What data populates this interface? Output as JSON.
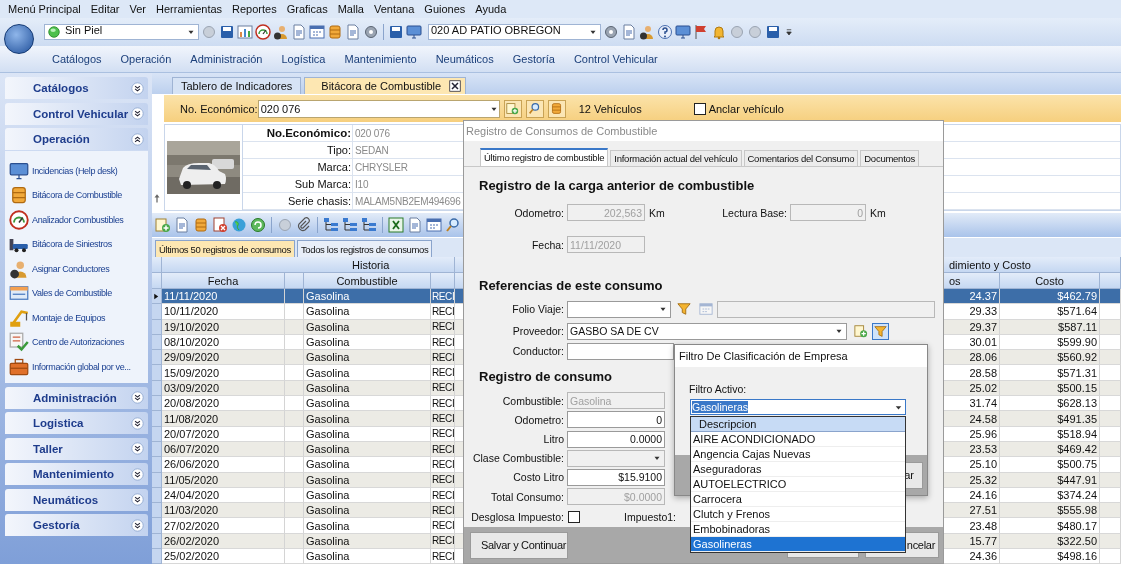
{
  "menu_bar": [
    "Menú Principal",
    "Editar",
    "Ver",
    "Herramientas",
    "Reportes",
    "Graficas",
    "Malla",
    "Ventana",
    "Guiones",
    "Ayuda"
  ],
  "toolbar": {
    "profile": "Sin Piel",
    "location": "020 AD PATIO OBREGON"
  },
  "ribbon_tabs": [
    "Catálogos",
    "Operación",
    "Administración",
    "Logística",
    "Mantenimiento",
    "Neumáticos",
    "Gestoría",
    "Control Vehicular"
  ],
  "sidebar": {
    "sections": [
      {
        "title": "Catálogos",
        "expanded": false
      },
      {
        "title": "Control Vehicular",
        "expanded": false
      },
      {
        "title": "Operación",
        "expanded": true,
        "items": [
          "Incidencias (Help desk)",
          "Bitácora de Combustible",
          "Analizador Combustibles",
          "Bitácora de Siniestros",
          "Asignar Conductores",
          "Vales de Combustible",
          "Montaje de Equipos",
          "Centro de Autorizaciones",
          "Información global por ve..."
        ]
      },
      {
        "title": "Administración",
        "expanded": false
      },
      {
        "title": "Logistica",
        "expanded": false
      },
      {
        "title": "Taller",
        "expanded": false
      },
      {
        "title": "Mantenimiento",
        "expanded": false
      },
      {
        "title": "Neumáticos",
        "expanded": false
      },
      {
        "title": "Gestoría",
        "expanded": false
      }
    ]
  },
  "document_tabs": [
    {
      "label": "Tablero de Indicadores",
      "selected": false,
      "closable": false
    },
    {
      "label": "Bitácora de Combustible",
      "selected": true,
      "closable": true
    }
  ],
  "vehicle_bar": {
    "label": "No. Económico:",
    "value": "020 076",
    "count": "12 Vehículos",
    "pin": {
      "label": "Anclar vehículo",
      "checked": false
    }
  },
  "vehicle_info": {
    "fields": [
      {
        "label": "No.Económico:",
        "value": "020 076"
      },
      {
        "label": "Tipo:",
        "value": "SEDAN"
      },
      {
        "label": "Marca:",
        "value": "CHRYSLER"
      },
      {
        "label": "Sub Marca:",
        "value": "I10"
      },
      {
        "label": "Serie chasis:",
        "value": "MALAM5NB2EM494696"
      }
    ]
  },
  "record_tabs": [
    {
      "label": "Últimos 50 registros de consumos",
      "selected": true
    },
    {
      "label": "Todos los registros de consumos",
      "selected": false
    }
  ],
  "grid": {
    "group_headers": [
      "Historia",
      "dimiento y Costo"
    ],
    "columns": {
      "fecha": "Fecha",
      "combustible": "Combustible",
      "column_4": "os",
      "costo": "Costo"
    },
    "rows": [
      {
        "fecha": "11/11/2020",
        "combustible": "Gasolina",
        "column_3": "RECI",
        "column_4": "24.37",
        "costo": "$462.79",
        "selected": true
      },
      {
        "fecha": "10/11/2020",
        "combustible": "Gasolina",
        "column_3": "RECI",
        "column_4": "29.33",
        "costo": "$571.64",
        "selected": false
      },
      {
        "fecha": "19/10/2020",
        "combustible": "Gasolina",
        "column_3": "RECI",
        "column_4": "29.37",
        "costo": "$587.11",
        "selected": false
      },
      {
        "fecha": "08/10/2020",
        "combustible": "Gasolina",
        "column_3": "RECI",
        "column_4": "30.01",
        "costo": "$599.90",
        "selected": false
      },
      {
        "fecha": "29/09/2020",
        "combustible": "Gasolina",
        "column_3": "RECI",
        "column_4": "28.06",
        "costo": "$560.92",
        "selected": false
      },
      {
        "fecha": "15/09/2020",
        "combustible": "Gasolina",
        "column_3": "RECI",
        "column_4": "28.58",
        "costo": "$571.31",
        "selected": false
      },
      {
        "fecha": "03/09/2020",
        "combustible": "Gasolina",
        "column_3": "RECI",
        "column_4": "25.02",
        "costo": "$500.15",
        "selected": false
      },
      {
        "fecha": "20/08/2020",
        "combustible": "Gasolina",
        "column_3": "RECI",
        "column_4": "31.74",
        "costo": "$628.13",
        "selected": false
      },
      {
        "fecha": "11/08/2020",
        "combustible": "Gasolina",
        "column_3": "RECI",
        "column_4": "24.58",
        "costo": "$491.35",
        "selected": false
      },
      {
        "fecha": "20/07/2020",
        "combustible": "Gasolina",
        "column_3": "RECI",
        "column_4": "25.96",
        "costo": "$518.94",
        "selected": false
      },
      {
        "fecha": "06/07/2020",
        "combustible": "Gasolina",
        "column_3": "RECI",
        "column_4": "23.53",
        "costo": "$469.42",
        "selected": false
      },
      {
        "fecha": "26/06/2020",
        "combustible": "Gasolina",
        "column_3": "RECI",
        "column_4": "25.10",
        "costo": "$500.75",
        "selected": false
      },
      {
        "fecha": "11/05/2020",
        "combustible": "Gasolina",
        "column_3": "RECI",
        "column_4": "25.32",
        "costo": "$447.91",
        "selected": false
      },
      {
        "fecha": "24/04/2020",
        "combustible": "Gasolina",
        "column_3": "RECI",
        "column_4": "24.16",
        "costo": "$374.24",
        "selected": false
      },
      {
        "fecha": "11/03/2020",
        "combustible": "Gasolina",
        "column_3": "RECI",
        "column_4": "27.51",
        "costo": "$555.98",
        "selected": false
      },
      {
        "fecha": "27/02/2020",
        "combustible": "Gasolina",
        "column_3": "RECI",
        "column_4": "23.48",
        "costo": "$480.17",
        "selected": false
      },
      {
        "fecha": "26/02/2020",
        "combustible": "Gasolina",
        "column_3": "RECI",
        "column_4": "15.77",
        "costo": "$322.50",
        "selected": false
      },
      {
        "fecha": "25/02/2020",
        "combustible": "Gasolina",
        "column_3": "RECI",
        "column_4": "24.36",
        "costo": "$498.16",
        "selected": false
      }
    ]
  },
  "dialog": {
    "title": "Registro de Consumos de Combustible",
    "tabs": [
      {
        "label": "Último registro de combustible",
        "selected": true
      },
      {
        "label": "Información actual del vehículo",
        "selected": false
      },
      {
        "label": "Comentarios del Consumo",
        "selected": false
      },
      {
        "label": "Documentos",
        "selected": false
      }
    ],
    "previous_load": {
      "heading": "Registro de la carga anterior de combustible",
      "odometer": {
        "label": "Odometro:",
        "value": "202,563",
        "unit": "Km"
      },
      "base_reading": {
        "label": "Lectura Base:",
        "value": "0",
        "unit": "Km"
      },
      "date": {
        "label": "Fecha:",
        "value": "11/11/2020"
      }
    },
    "references": {
      "heading": "Referencias de este consumo",
      "trip_folio": {
        "label": "Folio Viaje:"
      },
      "supplier": {
        "label": "Proveedor:",
        "value": "GASBO SA DE CV"
      },
      "driver": {
        "label": "Conductor:"
      }
    },
    "consumption": {
      "heading": "Registro de consumo",
      "fields": [
        {
          "label": "Combustible:",
          "value": "Gasolina",
          "kind": "text",
          "disabled": true
        },
        {
          "label": "Odometro:",
          "value": "0",
          "kind": "number",
          "disabled": false
        },
        {
          "label": "Litro",
          "value": "0.0000",
          "kind": "number",
          "disabled": false
        },
        {
          "label": "Clase Combustible:",
          "kind": "combo",
          "disabled": true
        },
        {
          "label": "Costo Litro",
          "value": "$15.9100",
          "kind": "number",
          "disabled": false
        },
        {
          "label": "Total Consumo:",
          "value": "$0.0000",
          "kind": "number",
          "disabled": true
        }
      ],
      "tax_breakdown": {
        "label": "Desglosa Impuesto:",
        "checked": false
      },
      "tax1": {
        "label": "Impuesto1:"
      }
    },
    "buttons": [
      {
        "kind": "save",
        "label": "Salvar y Continuar"
      },
      {
        "kind": "accept"
      },
      {
        "kind": "cancel",
        "label": "ncelar"
      }
    ]
  },
  "filter_popup": {
    "title": "Filtro De Clasificación de Empresa",
    "label": "Filtro Activo:",
    "value": "Gasolineras",
    "list_header": "Descripcion",
    "button": "ar",
    "options": [
      {
        "label": "AIRE ACONDICIONADO",
        "selected": false
      },
      {
        "label": "Angencia Cajas Nuevas",
        "selected": false
      },
      {
        "label": "Aseguradoras",
        "selected": false
      },
      {
        "label": "AUTOELECTRICO",
        "selected": false
      },
      {
        "label": "Carrocera",
        "selected": false
      },
      {
        "label": "Clutch y Frenos",
        "selected": false
      },
      {
        "label": "Embobinadoras",
        "selected": false
      },
      {
        "label": "Gasolineras",
        "selected": true
      }
    ]
  }
}
